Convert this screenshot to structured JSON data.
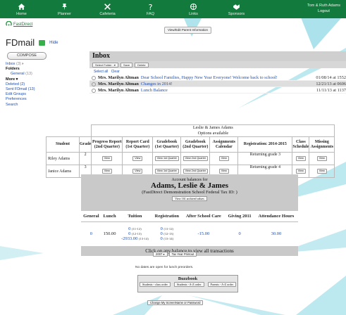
{
  "nav": {
    "items": [
      {
        "label": "Home",
        "icon": "home-icon"
      },
      {
        "label": "Planner",
        "icon": "pin-icon"
      },
      {
        "label": "Cafeteria",
        "icon": "utensils-icon"
      },
      {
        "label": "FAQ",
        "icon": "question-icon"
      },
      {
        "label": "Links",
        "icon": "globe-icon"
      },
      {
        "label": "Sponsors",
        "icon": "handshake-icon"
      }
    ],
    "user": "Tom & Ruth Adams",
    "logout": "Logout",
    "bg_color": "#127a3c"
  },
  "logo_text": "FastDirect",
  "view_edit_parent": "View/Edit Parent Information",
  "fdmail": {
    "title": "FDmail",
    "hide": "Hide",
    "compose": "COMPOSE",
    "inbox_link": "Inbox",
    "inbox_count": "(3)",
    "folders": "Folders",
    "general": "General",
    "general_count": "(13)",
    "more": "More ▾",
    "deleted": "Deleted (2)",
    "sent": "Sent FDmail (13)",
    "edit_groups": "Edit Groups",
    "preferences": "Preferences",
    "search": "Search"
  },
  "inbox": {
    "title": "Inbox",
    "select_folder": "Select Folder :",
    "save": "Save",
    "delete": "Delete",
    "select_all": "Select all",
    "clear": "Clear",
    "messages": [
      {
        "from": "Mrs. Marilyn Altman",
        "subject": "Dear School Families, Happy New Year Everyone! Welcome back to school!",
        "date": "01/08/14 at 1552"
      },
      {
        "from": "Mrs. Marilyn Altman",
        "subject": "Changes in 2014!",
        "date": "12/21/13 at 0606"
      },
      {
        "from": "Mrs. Marilyn Altman",
        "subject": "Lunch Balance",
        "date": "11/11/13 at 1137"
      }
    ]
  },
  "students": {
    "caption": "Leslie & James Adams",
    "caption2": "Options available",
    "headers": [
      "Student",
      "Grade",
      "Progress Report (2nd Quarter)",
      "Report Card (1st Quarter)",
      "Gradebook (1st Quarter)",
      "Gradebook (2nd Quarter)",
      "Assignments Calendar",
      "Registration: 2014-2015",
      "Class Schedule",
      "Missing Assignments"
    ],
    "view": "View",
    "view_1st": "View 1st Quarter",
    "view_2nd": "View 2nd Quarter",
    "rows": [
      {
        "name": "Riley Adams",
        "grade": "2",
        "registration": "Returning grade 3"
      },
      {
        "name": "Janice Adams",
        "grade": "3",
        "registration": "Returning grade 4"
      }
    ]
  },
  "balances": {
    "for": "Account balances for",
    "name": "Adams, Leslie & James",
    "school": "(FastDirect Demonstration School Federal Tax ID: )",
    "archived": "View 161 archived values",
    "headers": [
      "General",
      "Lunch",
      "Tuition",
      "Registration",
      "After School Care",
      "Giving 2011",
      "Attendance Hours"
    ],
    "general": "0",
    "lunch": "150.00",
    "tuition": [
      {
        "value": "0",
        "years": "(11-12)"
      },
      {
        "value": "0",
        "years": "(12-13)"
      },
      {
        "value": "-2933.00",
        "years": "(13-14)"
      }
    ],
    "registration": [
      {
        "value": "0",
        "years": "(11-12)"
      },
      {
        "value": "0",
        "years": "(12-13)"
      },
      {
        "value": "0",
        "years": "(13-14)"
      }
    ],
    "after_school": "-15.00",
    "giving": "0",
    "attendance": "30.00",
    "footer": "Click on any balance to view all transactions"
  },
  "year_select": "2007",
  "tax_printout": "Tax Year Printout",
  "no_dates": "No dates are open for lunch preorders.",
  "buzzbook": {
    "title": "Buzzbook",
    "buttons": [
      "Students - class order",
      "Students - A-Z order",
      "Parents - A-Z order"
    ]
  },
  "change_pw": "Change My ScreenName or Password"
}
